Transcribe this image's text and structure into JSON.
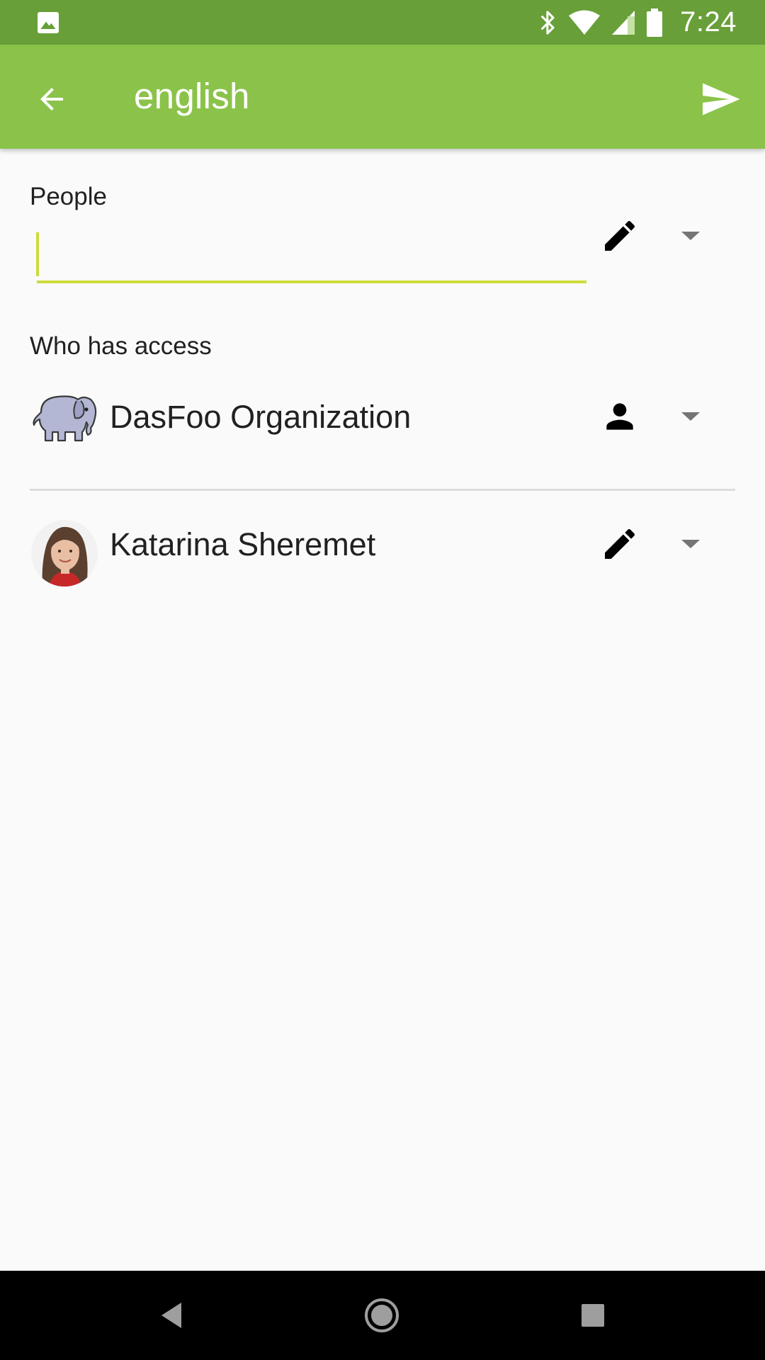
{
  "status_bar": {
    "time": "7:24",
    "icons": [
      "image-notification-icon",
      "bluetooth-icon",
      "wifi-icon",
      "cell-signal-icon",
      "battery-icon"
    ],
    "background": "#689f38"
  },
  "app_bar": {
    "title": "english",
    "back_icon": "arrow-back-icon",
    "send_icon": "send-icon",
    "background": "#8bc34a"
  },
  "people": {
    "label": "People",
    "input_value": "",
    "input_placeholder": "",
    "permission_icon": "pencil-icon",
    "accent": "#cddc39"
  },
  "access": {
    "label": "Who has access",
    "entries": [
      {
        "name": "DasFoo Organization",
        "avatar": "elephant-logo",
        "permission_icon": "person-icon"
      },
      {
        "name": "Katarina Sheremet",
        "avatar": "user-photo",
        "permission_icon": "pencil-icon"
      }
    ]
  },
  "nav_bar": {
    "buttons": [
      "nav-back-icon",
      "nav-home-icon",
      "nav-recents-icon"
    ]
  }
}
